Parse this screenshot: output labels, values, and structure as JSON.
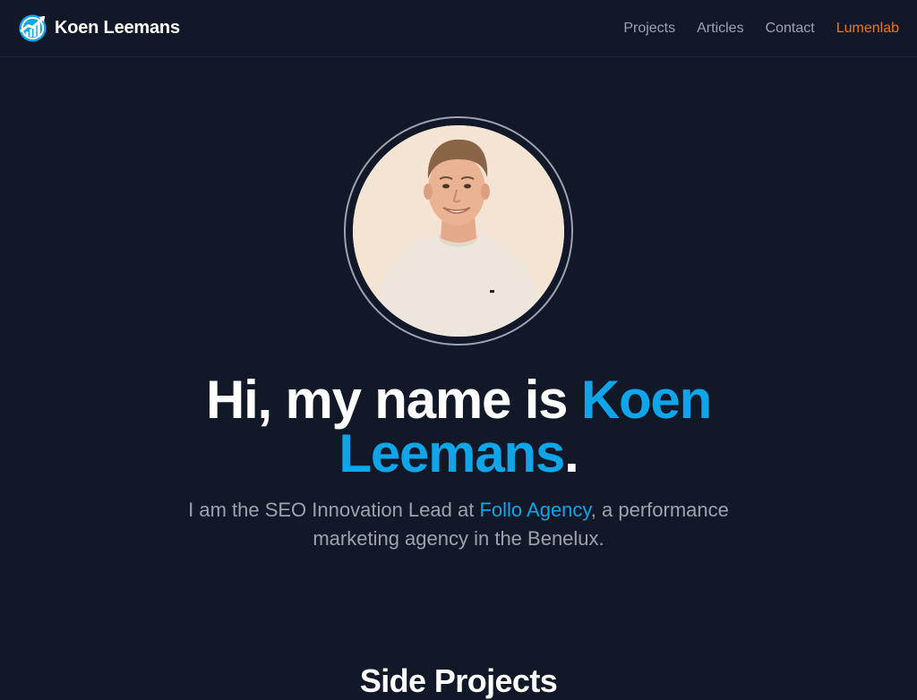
{
  "nav": {
    "brand": "Koen Leemans",
    "links": [
      {
        "label": "Projects"
      },
      {
        "label": "Articles"
      },
      {
        "label": "Contact"
      },
      {
        "label": "Lumenlab"
      }
    ],
    "accent_color": "#f97316",
    "brand_icon": "growth-chart-icon"
  },
  "hero": {
    "headline_prefix": "Hi, my name is",
    "headline_name_first": "Koen",
    "headline_name_last": "Leemans",
    "headline_suffix": ".",
    "subtitle_prefix": "I am the SEO Innovation Lead at",
    "subtitle_link": "Follo Agency",
    "subtitle_suffix": ", a performance marketing agency in the Benelux.",
    "accent_color": "#0ea5e9"
  },
  "sections": {
    "side_projects_title": "Side Projects"
  }
}
